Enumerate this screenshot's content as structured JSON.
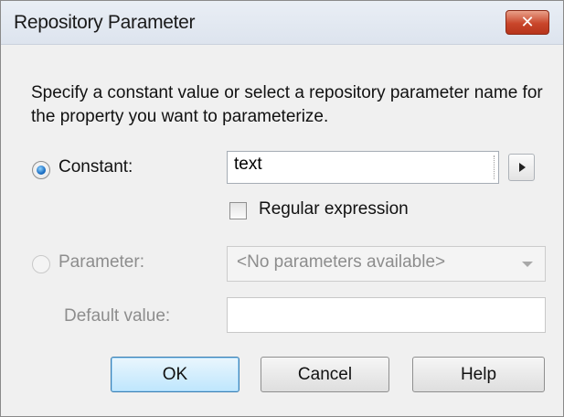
{
  "dialog": {
    "title": "Repository Parameter",
    "close_label": "✕",
    "description": "Specify a constant value or select a repository parameter name for the property you want to parameterize."
  },
  "constant": {
    "label": "Constant:",
    "selected": true,
    "value": "text",
    "regex_label": "Regular expression",
    "regex_checked": false
  },
  "parameter": {
    "label": "Parameter:",
    "selected": false,
    "dropdown_value": "<No parameters available>",
    "default_label": "Default value:",
    "default_value": ""
  },
  "buttons": {
    "ok": "OK",
    "cancel": "Cancel",
    "help": "Help"
  },
  "colors": {
    "close_button": "#c9462b",
    "default_button_border": "#3c7fb1",
    "disabled_text": "#8d8d8d"
  }
}
